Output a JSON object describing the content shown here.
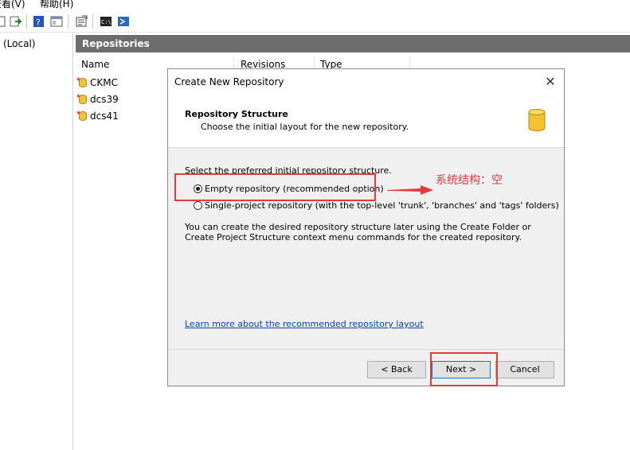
{
  "menubar": {
    "items": [
      {
        "label": "查看(V)"
      },
      {
        "label": "帮助(H)"
      }
    ]
  },
  "tree": {
    "local_label": "(Local)"
  },
  "repositories": {
    "header": "Repositories",
    "columns": [
      "Name",
      "Revisions",
      "Type"
    ],
    "rows": [
      {
        "name": "CKMC"
      },
      {
        "name": "dcs39"
      },
      {
        "name": "dcs41"
      }
    ]
  },
  "dialog": {
    "title": "Create New Repository",
    "close_glyph": "✕",
    "header_title": "Repository Structure",
    "header_subtitle": "Choose the initial layout for the new repository.",
    "prompt": "Select the preferred initial repository structure.",
    "options": [
      {
        "label": "Empty repository (recommended option)",
        "selected": true
      },
      {
        "label": "Single-project repository (with the top-level 'trunk', 'branches' and 'tags' folders)",
        "selected": false
      }
    ],
    "info": "You can create the desired repository structure later using the Create Folder or Create Project Structure context menu commands for the created repository.",
    "link": "Learn more about the recommended repository layout",
    "buttons": {
      "back": "< Back",
      "next": "Next >",
      "cancel": "Cancel"
    }
  },
  "annotation": {
    "text": "系统结构：空",
    "color": "#e23b3b"
  },
  "colors": {
    "header_bg": "#6d6d6d",
    "dialog_bg": "#f0f0f0",
    "link": "#0645ad",
    "accent": "#0078d7"
  }
}
